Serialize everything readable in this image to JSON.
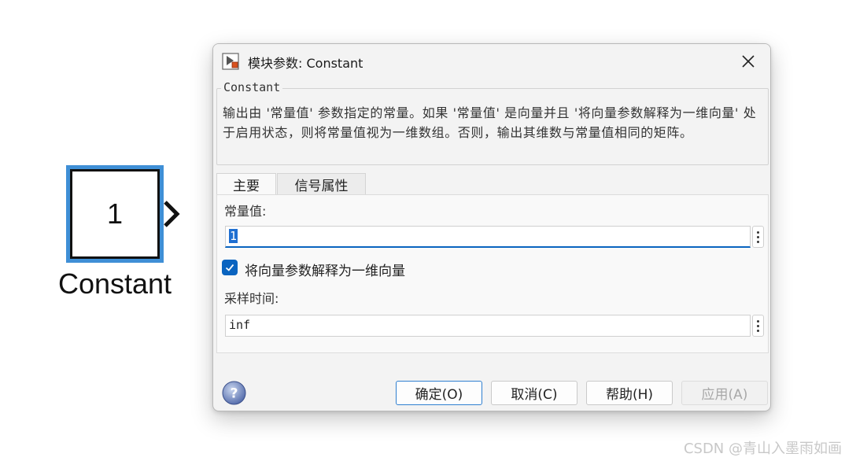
{
  "canvas": {
    "block_value": "1",
    "block_label": "Constant"
  },
  "dialog": {
    "title": "模块参数: Constant",
    "description_title": "Constant",
    "description": "输出由 '常量值' 参数指定的常量。如果 '常量值' 是向量并且 '将向量参数解释为一维向量' 处于启用状态，则将常量值视为一维数组。否则，输出其维数与常量值相同的矩阵。",
    "tabs": [
      {
        "label": "主要",
        "active": true
      },
      {
        "label": "信号属性",
        "active": false
      }
    ],
    "constant_value_label": "常量值:",
    "constant_value": "1",
    "interpret_vector_label": "将向量参数解释为一维向量",
    "interpret_vector_checked": true,
    "sample_time_label": "采样时间:",
    "sample_time": "inf",
    "buttons": {
      "ok": "确定(O)",
      "cancel": "取消(C)",
      "help": "帮助(H)",
      "apply": "应用(A)"
    }
  },
  "watermark": "CSDN @青山入墨雨如画",
  "colors": {
    "accent": "#0a64c0",
    "selection": "#3f8fd6"
  },
  "icons": [
    "simulink-block-icon",
    "close-icon",
    "more-options-icon",
    "checkmark-icon",
    "help-icon",
    "output-port-icon"
  ]
}
